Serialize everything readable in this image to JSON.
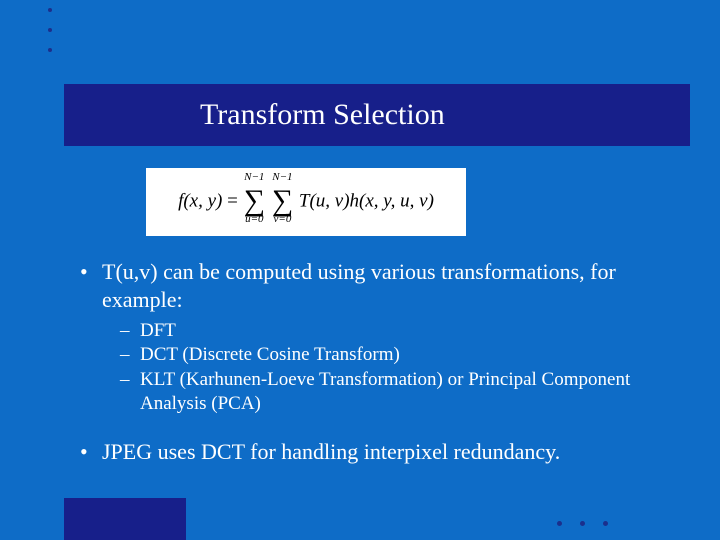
{
  "title": "Transform Selection",
  "formula": {
    "lhs": "f(x, y)",
    "eq": "=",
    "sum1": {
      "top": "N−1",
      "bottom": "u=0"
    },
    "sum2": {
      "top": "N−1",
      "bottom": "v=0"
    },
    "rhs": "T(u, v)h(x, y, u, v)"
  },
  "bullets": {
    "b1": "T(u,v) can be computed using various transformations, for example:",
    "sub": {
      "s1": "DFT",
      "s2": "DCT (Discrete Cosine Transform)",
      "s3": "KLT (Karhunen-Loeve Transformation) or Principal Component Analysis (PCA)"
    },
    "b2": "JPEG uses DCT for handling interpixel redundancy."
  }
}
